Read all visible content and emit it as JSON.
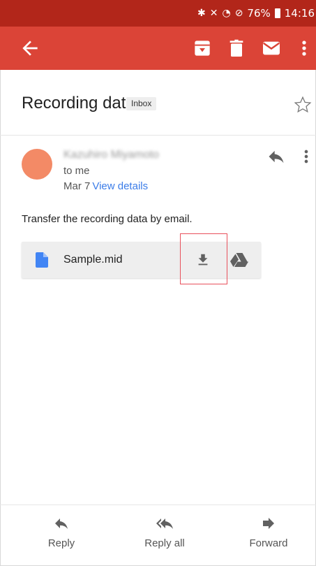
{
  "status_bar": {
    "bluetooth_icon": "bluetooth-icon",
    "mute_icon": "mute-icon",
    "wifi_icon": "wifi-icon",
    "dnd_icon": "do-not-disturb-icon",
    "battery": "76%",
    "time": "14:16"
  },
  "toolbar": {
    "colors": {
      "status": "#b2261a",
      "toolbar": "#db4437"
    }
  },
  "email": {
    "subject": "Recording data",
    "label": "Inbox",
    "sender_name": "Kazuhiro Miyamoto",
    "recipient": "to me",
    "date": "Mar 7",
    "view_details": "View details",
    "avatar_color": "#f38a66",
    "body": "Transfer the recording data by email."
  },
  "attachment": {
    "filename": "Sample.mid",
    "file_icon_color": "#4285f4"
  },
  "actions": {
    "reply": "Reply",
    "reply_all": "Reply all",
    "forward": "Forward"
  }
}
